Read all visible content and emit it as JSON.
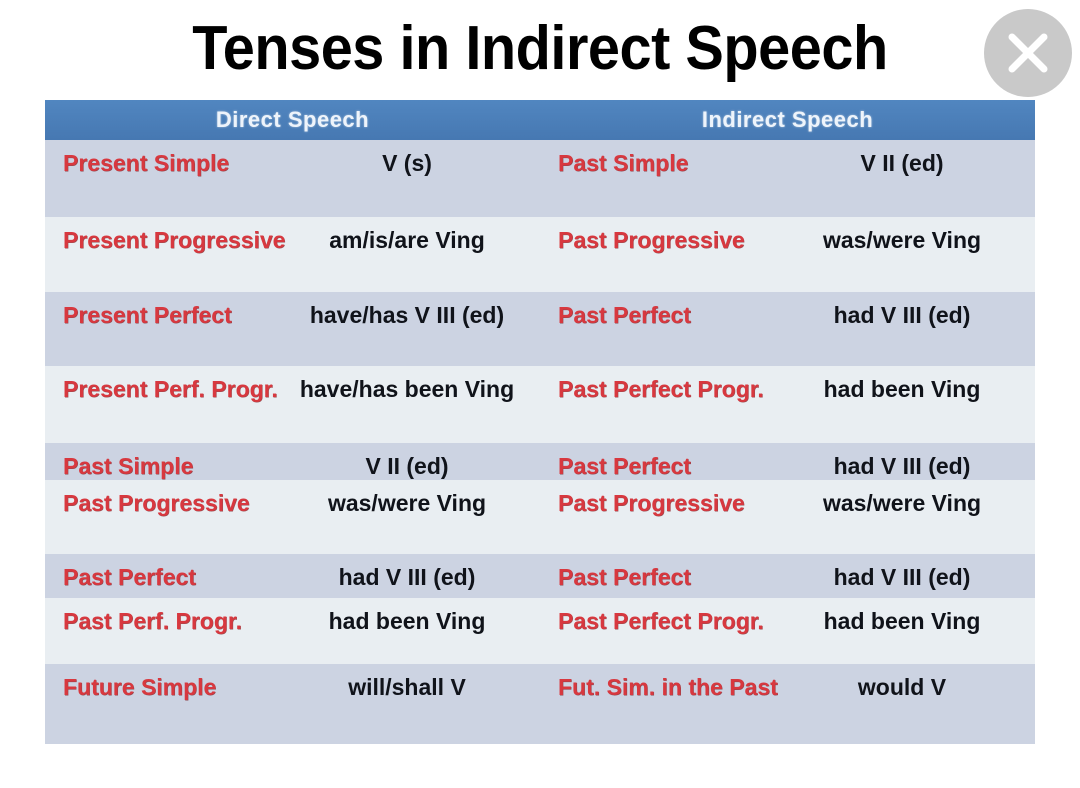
{
  "page": {
    "title": "Tenses in Indirect Speech"
  },
  "close_button": {
    "icon": "close-icon",
    "color": "#c9c9c9"
  },
  "table": {
    "header": {
      "direct": "Direct  Speech",
      "indirect": "Indirect  Speech",
      "background": "#4a7fba",
      "text_color": "#eef4fb"
    },
    "colors": {
      "row_dark": "#ccd3e2",
      "row_light": "#e9eef2",
      "tense_text": "#d8383f",
      "form_text": "#10131a"
    },
    "rows": [
      {
        "direct_tense": "Present Simple",
        "direct_form": "V (s)",
        "indirect_tense": "Past Simple",
        "indirect_form": "V II (ed)"
      },
      {
        "direct_tense": "Present Progressive",
        "direct_form": "am/is/are  Ving",
        "indirect_tense": "Past Progressive",
        "indirect_form": "was/were  Ving"
      },
      {
        "direct_tense": "Present Perfect",
        "direct_form": "have/has  V III (ed)",
        "indirect_tense": "Past Perfect",
        "indirect_form": "had  V III (ed)"
      },
      {
        "direct_tense": "Present Perf. Progr.",
        "direct_form": "have/has been Ving",
        "indirect_tense": "Past Perfect Progr.",
        "indirect_form": "had  been  Ving"
      },
      {
        "direct_tense": "Past Simple",
        "direct_form": "V II (ed)",
        "indirect_tense": "Past Perfect",
        "indirect_form": "had  V III (ed)"
      },
      {
        "direct_tense": "Past Progressive",
        "direct_form": "was/were  Ving",
        "indirect_tense": "Past Progressive",
        "indirect_form": "was/were  Ving"
      },
      {
        "direct_tense": "Past Perfect",
        "direct_form": "had  V III (ed)",
        "indirect_tense": "Past Perfect",
        "indirect_form": "had  V III (ed)"
      },
      {
        "direct_tense": "Past Perf. Progr.",
        "direct_form": "had  been  Ving",
        "indirect_tense": "Past Perfect Progr.",
        "indirect_form": "had  been  Ving"
      },
      {
        "direct_tense": "Future Simple",
        "direct_form": "will/shall  V",
        "indirect_tense": "Fut. Sim. in the Past",
        "indirect_form": "would  V"
      }
    ]
  }
}
